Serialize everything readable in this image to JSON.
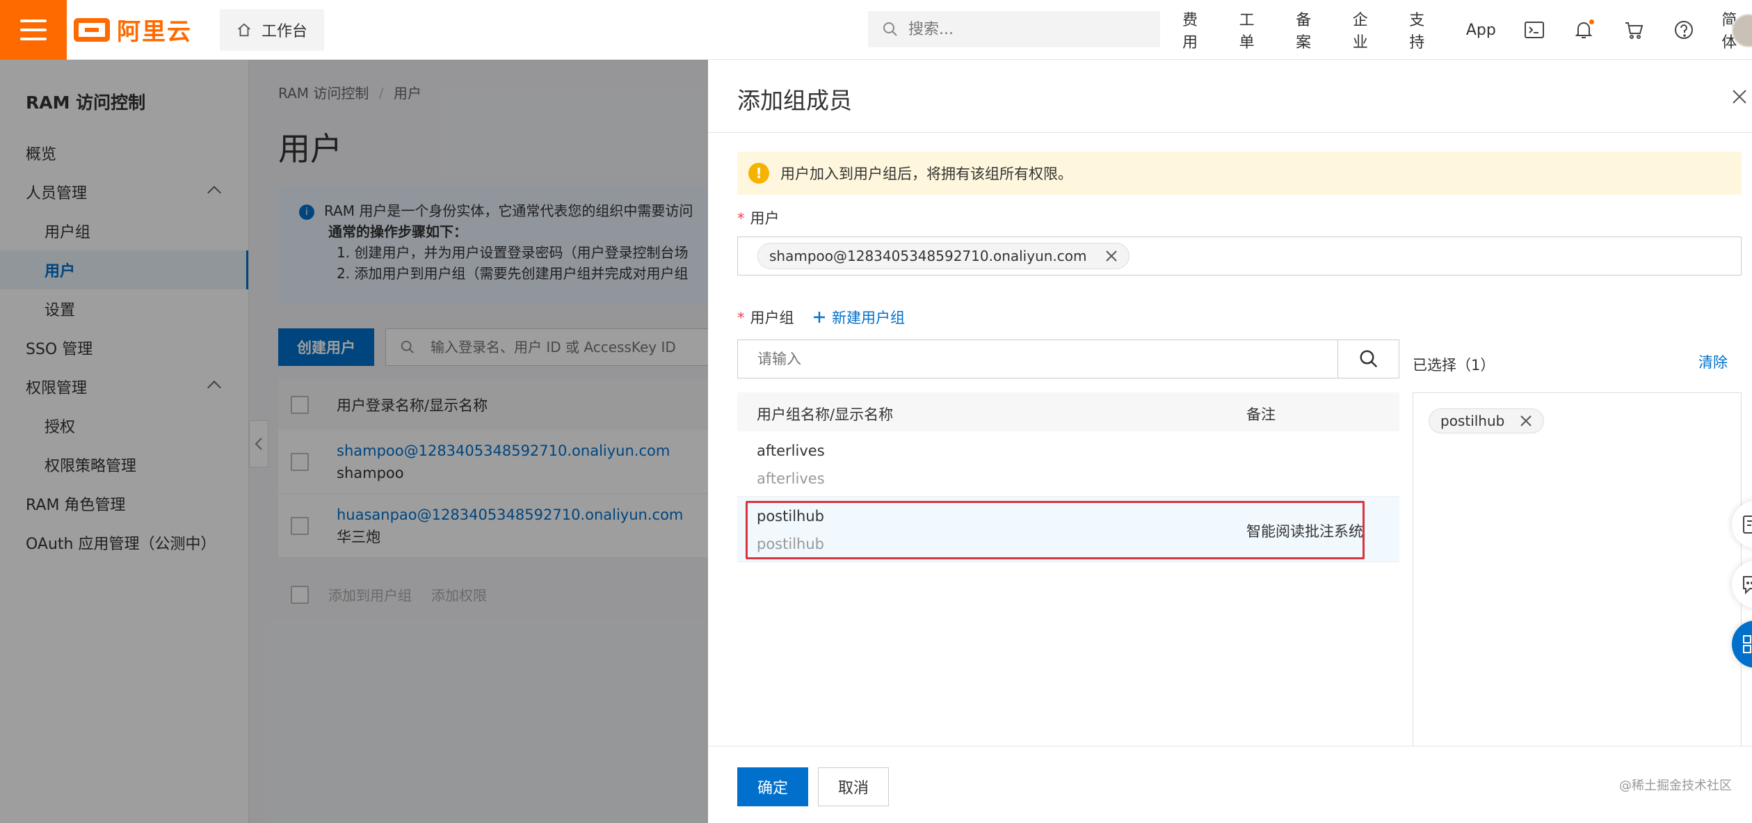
{
  "topbar": {
    "logo_text": "阿里云",
    "workbench": "工作台",
    "search_placeholder": "搜索...",
    "nav": [
      "费用",
      "工单",
      "备案",
      "企业",
      "支持",
      "App"
    ],
    "lang": "简体",
    "brand_color": "#ff6a00"
  },
  "sidebar": {
    "title": "RAM 访问控制",
    "items": [
      {
        "label": "概览"
      },
      {
        "label": "人员管理"
      },
      {
        "label": "用户组"
      },
      {
        "label": "用户"
      },
      {
        "label": "设置"
      },
      {
        "label": "SSO 管理"
      },
      {
        "label": "权限管理"
      },
      {
        "label": "授权"
      },
      {
        "label": "权限策略管理"
      },
      {
        "label": "RAM 角色管理"
      },
      {
        "label": "OAuth 应用管理（公测中）"
      }
    ]
  },
  "main": {
    "breadcrumb_root": "RAM 访问控制",
    "breadcrumb_sep": "/",
    "breadcrumb_current": "用户",
    "title": "用户",
    "info_intro": "RAM 用户是一个身份实体，它通常代表您的组织中需要访问",
    "info_steps_title": "通常的操作步骤如下：",
    "info_step1": "1. 创建用户，并为用户设置登录密码（用户登录控制台场",
    "info_step2": "2. 添加用户到用户组（需要先创建用户组并完成对用户组",
    "create_button": "创建用户",
    "search_placeholder": "输入登录名、用户 ID 或 AccessKey ID",
    "column_name": "用户登录名称/显示名称",
    "rows": [
      {
        "login": "shampoo@1283405348592710.onaliyun.com",
        "display": "shampoo"
      },
      {
        "login": "huasanpao@1283405348592710.onaliyun.com",
        "display": "华三炮"
      }
    ],
    "bulk_add_group": "添加到用户组",
    "bulk_add_perm": "添加权限"
  },
  "drawer": {
    "title": "添加组成员",
    "warning": "用户加入到用户组后，将拥有该组所有权限。",
    "user_label": "用户",
    "user_tag": "shampoo@1283405348592710.onaliyun.com",
    "group_label": "用户组",
    "new_group": "新建用户组",
    "group_search_placeholder": "请输入",
    "col_name": "用户组名称/显示名称",
    "col_remark": "备注",
    "groups": [
      {
        "name": "afterlives",
        "display": "afterlives",
        "remark": ""
      },
      {
        "name": "postilhub",
        "display": "postilhub",
        "remark": "智能阅读批注系统"
      }
    ],
    "selected_title": "已选择（1）",
    "clear": "清除",
    "selected_tag": "postilhub",
    "ok": "确定",
    "cancel": "取消",
    "watermark": "@稀土掘金技术社区",
    "accent_color": "#0070cc",
    "highlight_color": "#d9333f"
  }
}
